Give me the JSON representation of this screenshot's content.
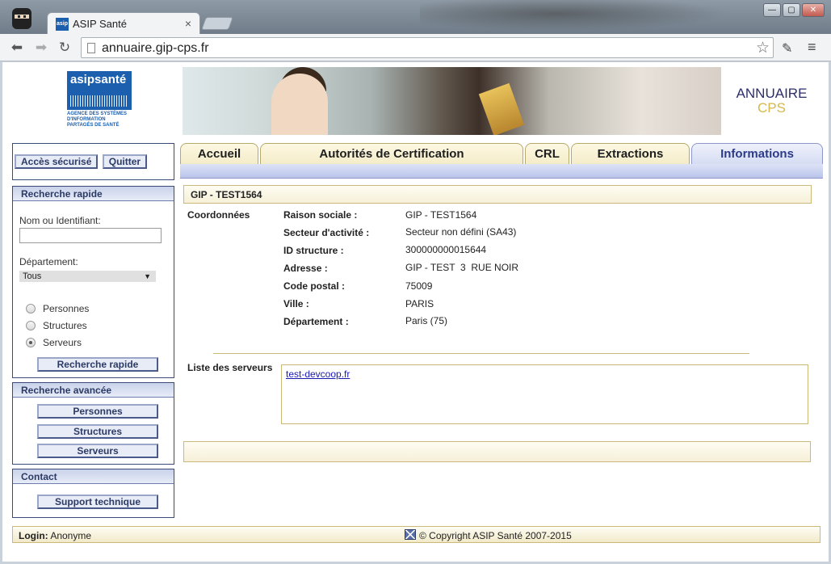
{
  "browser": {
    "tab_title": "ASIP Santé",
    "url": "annuaire.gip-cps.fr",
    "favicon_text": "asip",
    "icons": [
      "back-icon",
      "forward-icon",
      "reload-icon",
      "page-icon",
      "bookmark-star-icon",
      "eyedropper-icon",
      "menu-icon",
      "minimize-icon",
      "maximize-icon",
      "close-icon"
    ]
  },
  "header": {
    "logo_text": "asipsanté",
    "logo_tagline": [
      "AGENCE DES SYSTÈMES",
      "D'INFORMATION",
      "PARTAGÉS DE SANTÉ"
    ],
    "annuaire": "ANNUAIRE",
    "cps": "CPS"
  },
  "sidebar": {
    "secure_access": "Accès sécurisé",
    "quit": "Quitter",
    "quick_search": {
      "title": "Recherche rapide",
      "name_label": "Nom ou Identifiant:",
      "name_value": "",
      "dept_label": "Département:",
      "dept_value": "Tous",
      "radios": [
        {
          "label": "Personnes",
          "checked": false
        },
        {
          "label": "Structures",
          "checked": false
        },
        {
          "label": "Serveurs",
          "checked": true
        }
      ],
      "button": "Recherche rapide"
    },
    "advanced_search": {
      "title": "Recherche avancée",
      "buttons": [
        "Personnes",
        "Structures",
        "Serveurs"
      ]
    },
    "contact": {
      "title": "Contact",
      "button": "Support technique"
    }
  },
  "tabs": [
    {
      "label": "Accueil",
      "active": false
    },
    {
      "label": "Autorités de Certification",
      "active": false
    },
    {
      "label": "CRL",
      "active": false
    },
    {
      "label": "Extractions",
      "active": false
    },
    {
      "label": "Informations",
      "active": true
    }
  ],
  "main": {
    "title": "GIP - TEST1564",
    "coords_label": "Coordonnées",
    "fields": [
      {
        "key": "Raison sociale :",
        "value": "GIP - TEST1564"
      },
      {
        "key": "Secteur d'activité :",
        "value": "Secteur non défini (SA43)"
      },
      {
        "key": "ID structure :",
        "value": "300000000015644"
      },
      {
        "key": "Adresse :",
        "value": "GIP - TEST  3  RUE NOIR"
      },
      {
        "key": "Code postal :",
        "value": "75009"
      },
      {
        "key": "Ville :",
        "value": "PARIS"
      },
      {
        "key": "Département :",
        "value": "Paris (75)"
      }
    ],
    "servers_label": "Liste des serveurs",
    "servers": [
      "test-devcoop.fr"
    ]
  },
  "footer": {
    "login_label": "Login:",
    "login_value": "Anonyme",
    "copyright": "© Copyright ASIP Santé 2007-2015"
  },
  "colors": {
    "accent_blue": "#2c3a66",
    "gold": "#d8b84a",
    "brand_blue": "#1b5fae"
  }
}
